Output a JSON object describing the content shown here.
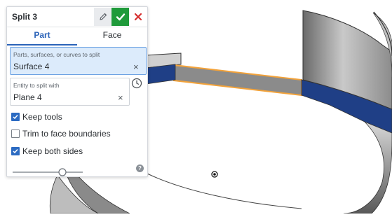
{
  "panel": {
    "title": "Split 3",
    "tabs": [
      "Part",
      "Face"
    ],
    "field1": {
      "label": "Parts, surfaces, or curves to split",
      "value": "Surface 4",
      "clear": "×"
    },
    "field2": {
      "label": "Entity to split with",
      "value": "Plane 4",
      "clear": "×"
    },
    "checkboxes": [
      {
        "label": "Keep tools",
        "checked": true
      },
      {
        "label": "Trim to face boundaries",
        "checked": false
      },
      {
        "label": "Keep both sides",
        "checked": true
      }
    ],
    "help": "?"
  },
  "icons": {
    "edit": "pencil-icon",
    "accept": "checkmark-icon",
    "cancel": "close-x-icon",
    "history": "history-clock-icon",
    "origin": "origin-point-icon"
  },
  "colors": {
    "accent": "#2b63b8",
    "accept_bg": "#1f9a3a",
    "cancel_fg": "#d62f2f",
    "selected_face": "#1f3f86",
    "highlight_edge": "#f2a23a"
  }
}
